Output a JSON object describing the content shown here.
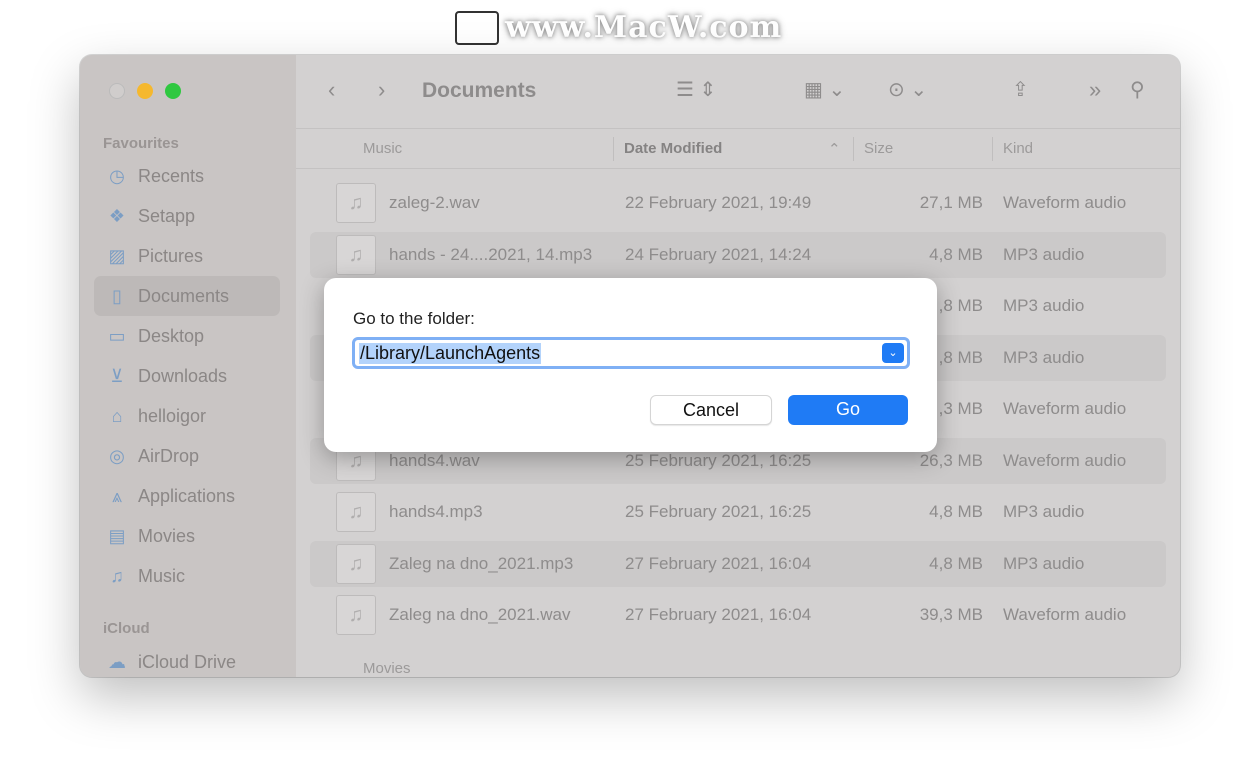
{
  "watermark": "www.MacW.com",
  "window": {
    "title": "Documents",
    "colors": {
      "close": "#d0cdcc",
      "minimize": "#f5b82e",
      "zoom": "#2fc840"
    }
  },
  "sidebar": {
    "favourites_label": "Favourites",
    "items": [
      {
        "label": "Recents",
        "icon": "clock-icon"
      },
      {
        "label": "Setapp",
        "icon": "setapp-icon"
      },
      {
        "label": "Pictures",
        "icon": "pictures-icon"
      },
      {
        "label": "Documents",
        "icon": "document-icon",
        "selected": true
      },
      {
        "label": "Desktop",
        "icon": "desktop-icon"
      },
      {
        "label": "Downloads",
        "icon": "download-icon"
      },
      {
        "label": "helloigor",
        "icon": "home-icon"
      },
      {
        "label": "AirDrop",
        "icon": "airdrop-icon"
      },
      {
        "label": "Applications",
        "icon": "applications-icon"
      },
      {
        "label": "Movies",
        "icon": "film-icon"
      },
      {
        "label": "Music",
        "icon": "music-icon"
      }
    ],
    "icloud_label": "iCloud",
    "icloud_items": [
      {
        "label": "iCloud Drive",
        "icon": "cloud-icon"
      }
    ]
  },
  "columns": {
    "name": "Music",
    "date": "Date Modified",
    "size": "Size",
    "kind": "Kind"
  },
  "files": [
    {
      "name": "zaleg-2.wav",
      "date": "22 February 2021, 19:49",
      "size": "27,1 MB",
      "kind": "Waveform audio"
    },
    {
      "name": "hands - 24....2021, 14.mp3",
      "date": "24 February 2021, 14:24",
      "size": "4,8 MB",
      "kind": "MP3 audio"
    },
    {
      "name": "",
      "date": "",
      "size": ",8 MB",
      "kind": "MP3 audio"
    },
    {
      "name": "",
      "date": "",
      "size": ",8 MB",
      "kind": "MP3 audio"
    },
    {
      "name": "",
      "date": "",
      "size": ",3 MB",
      "kind": "Waveform audio"
    },
    {
      "name": "hands4.wav",
      "date": "25 February 2021, 16:25",
      "size": "26,3 MB",
      "kind": "Waveform audio"
    },
    {
      "name": "hands4.mp3",
      "date": "25 February 2021, 16:25",
      "size": "4,8 MB",
      "kind": "MP3 audio"
    },
    {
      "name": "Zaleg na dno_2021.mp3",
      "date": "27 February 2021, 16:04",
      "size": "4,8 MB",
      "kind": "MP3 audio"
    },
    {
      "name": "Zaleg na dno_2021.wav",
      "date": "27 February 2021, 16:04",
      "size": "39,3 MB",
      "kind": "Waveform audio"
    }
  ],
  "next_group": "Movies",
  "dialog": {
    "label": "Go to the folder:",
    "path": "/Library/LaunchAgents",
    "cancel": "Cancel",
    "go": "Go"
  }
}
